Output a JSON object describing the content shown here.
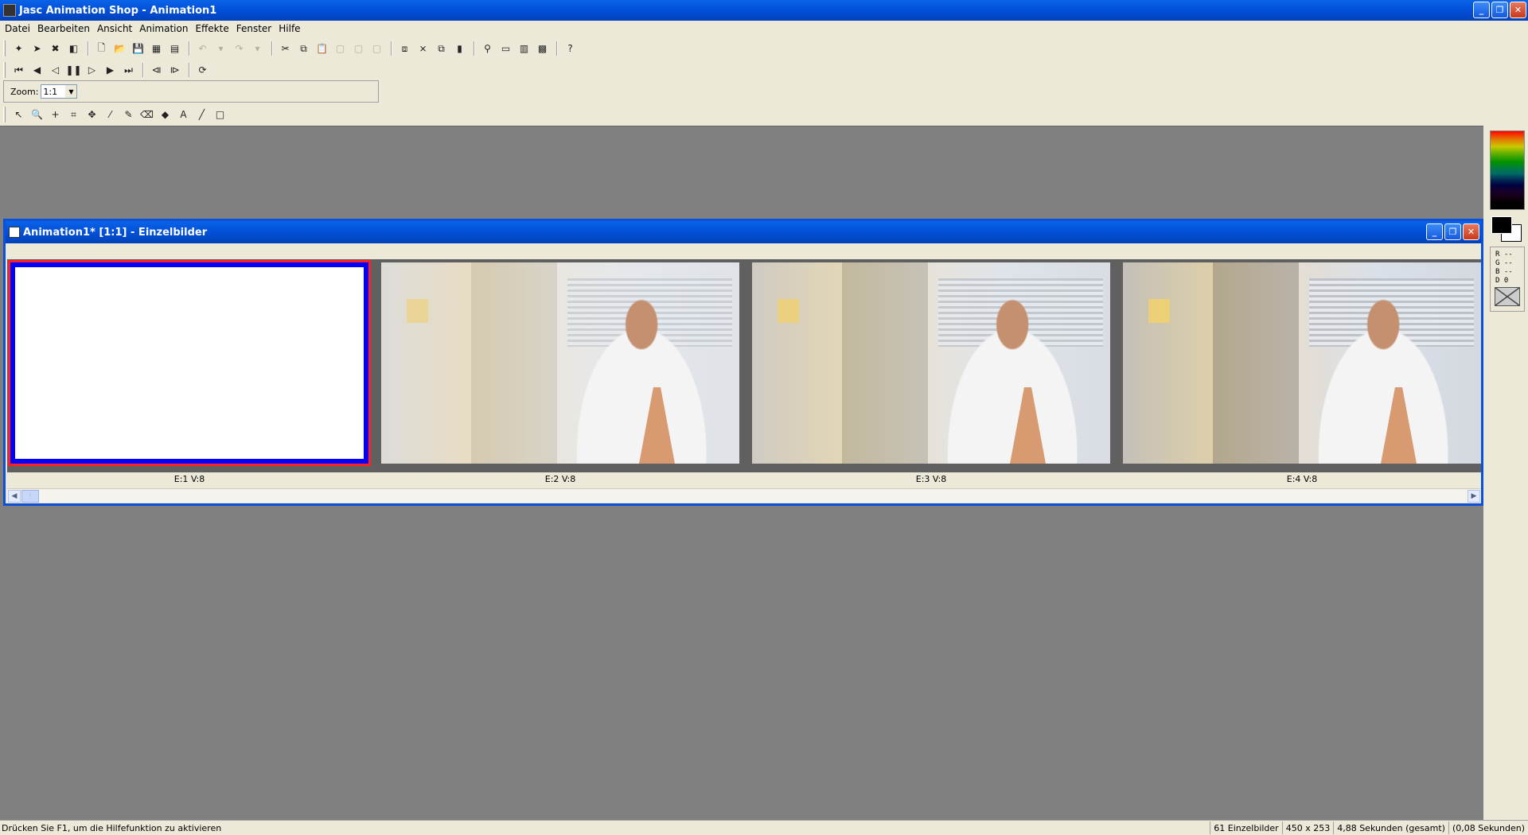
{
  "app": {
    "title": "Jasc Animation Shop - Animation1",
    "window_buttons": {
      "minimize": "_",
      "restore": "❐",
      "close": "✕"
    }
  },
  "menu": [
    "Datei",
    "Bearbeiten",
    "Ansicht",
    "Animation",
    "Effekte",
    "Fenster",
    "Hilfe"
  ],
  "toolbar_main": [
    {
      "icon": "wizard-icon",
      "glyph": "✦",
      "enabled": true
    },
    {
      "icon": "banner-wizard-icon",
      "glyph": "➤",
      "enabled": true
    },
    {
      "icon": "optimize-icon",
      "glyph": "✖",
      "enabled": true
    },
    {
      "icon": "transition-icon",
      "glyph": "◧",
      "enabled": true
    },
    {
      "icon": "new-icon",
      "glyph": "🗋",
      "enabled": true
    },
    {
      "icon": "open-icon",
      "glyph": "📂",
      "enabled": true
    },
    {
      "icon": "save-icon",
      "glyph": "💾",
      "enabled": true
    },
    {
      "icon": "save-all-icon",
      "glyph": "▦",
      "enabled": true
    },
    {
      "icon": "batch-icon",
      "glyph": "▤",
      "enabled": true
    },
    {
      "icon": "undo-icon",
      "glyph": "↶",
      "enabled": false
    },
    {
      "icon": "undo-dropdown-icon",
      "glyph": "▾",
      "enabled": false
    },
    {
      "icon": "redo-icon",
      "glyph": "↷",
      "enabled": false
    },
    {
      "icon": "redo-dropdown-icon",
      "glyph": "▾",
      "enabled": false
    },
    {
      "icon": "cut-icon",
      "glyph": "✂",
      "enabled": true
    },
    {
      "icon": "copy-icon",
      "glyph": "⧉",
      "enabled": true
    },
    {
      "icon": "paste-icon",
      "glyph": "📋",
      "enabled": false
    },
    {
      "icon": "paste-before-icon",
      "glyph": "▢",
      "enabled": false
    },
    {
      "icon": "paste-after-icon",
      "glyph": "▢",
      "enabled": false
    },
    {
      "icon": "paste-into-icon",
      "glyph": "▢",
      "enabled": false
    },
    {
      "icon": "insert-frames-icon",
      "glyph": "⧈",
      "enabled": true
    },
    {
      "icon": "delete-frames-icon",
      "glyph": "⨯",
      "enabled": true
    },
    {
      "icon": "duplicate-frames-icon",
      "glyph": "⧉",
      "enabled": true
    },
    {
      "icon": "highlight-icon",
      "glyph": "▮",
      "enabled": true
    },
    {
      "icon": "view-animation-icon",
      "glyph": "⚲",
      "enabled": true
    },
    {
      "icon": "frame-view-icon",
      "glyph": "▭",
      "enabled": true
    },
    {
      "icon": "color-bars-icon",
      "glyph": "▥",
      "enabled": true
    },
    {
      "icon": "filmstrip-icon",
      "glyph": "▩",
      "enabled": true
    },
    {
      "icon": "context-help-icon",
      "glyph": "?",
      "enabled": true
    }
  ],
  "toolbar_vcr": [
    {
      "icon": "first-frame-icon",
      "glyph": "⏮"
    },
    {
      "icon": "previous-frame-icon",
      "glyph": "◀"
    },
    {
      "icon": "play-reverse-icon",
      "glyph": "◁"
    },
    {
      "icon": "pause-icon",
      "glyph": "❚❚"
    },
    {
      "icon": "play-icon",
      "glyph": "▷"
    },
    {
      "icon": "next-frame-icon",
      "glyph": "▶"
    },
    {
      "icon": "last-frame-icon",
      "glyph": "⏭"
    },
    {
      "icon": "step-back-icon",
      "glyph": "⧏"
    },
    {
      "icon": "step-forward-icon",
      "glyph": "⧐"
    },
    {
      "icon": "loop-icon",
      "glyph": "⟳"
    }
  ],
  "zoom": {
    "label": "Zoom:",
    "value": "1:1"
  },
  "toolbar_tools": [
    {
      "icon": "arrow-tool-icon",
      "glyph": "↖"
    },
    {
      "icon": "magnifier-tool-icon",
      "glyph": "🔍"
    },
    {
      "icon": "crosshair-tool-icon",
      "glyph": "+"
    },
    {
      "icon": "crop-tool-icon",
      "glyph": "⌗"
    },
    {
      "icon": "move-tool-icon",
      "glyph": "✥"
    },
    {
      "icon": "dropper-tool-icon",
      "glyph": "⁄"
    },
    {
      "icon": "brush-tool-icon",
      "glyph": "✎"
    },
    {
      "icon": "eraser-tool-icon",
      "glyph": "⌫"
    },
    {
      "icon": "fill-tool-icon",
      "glyph": "◆"
    },
    {
      "icon": "text-tool-icon",
      "glyph": "A"
    },
    {
      "icon": "line-tool-icon",
      "glyph": "╱"
    },
    {
      "icon": "shape-tool-icon",
      "glyph": "□"
    }
  ],
  "palette": {
    "r": "R --",
    "g": "G --",
    "b": "B --",
    "d": "D 0"
  },
  "document": {
    "title": "Animation1* [1:1] - Einzelbilder",
    "frames": [
      {
        "label": "E:1  V:8",
        "selected": true
      },
      {
        "label": "E:2  V:8",
        "selected": false
      },
      {
        "label": "E:3  V:8",
        "selected": false
      },
      {
        "label": "E:4  V:8",
        "selected": false
      }
    ],
    "scroll_left": "◀",
    "scroll_right": "▶"
  },
  "status": {
    "message": "Drücken Sie F1, um die Hilfefunktion zu aktivieren",
    "frames": "61 Einzelbilder",
    "size": "450 x 253",
    "total": "4,88 Sekunden (gesamt)",
    "per_frame": "(0,08 Sekunden)"
  },
  "colors": {
    "accent": "#0250d8",
    "workspace": "#808080",
    "selection_blue": "#0000ff",
    "selection_red": "#ff2020"
  }
}
